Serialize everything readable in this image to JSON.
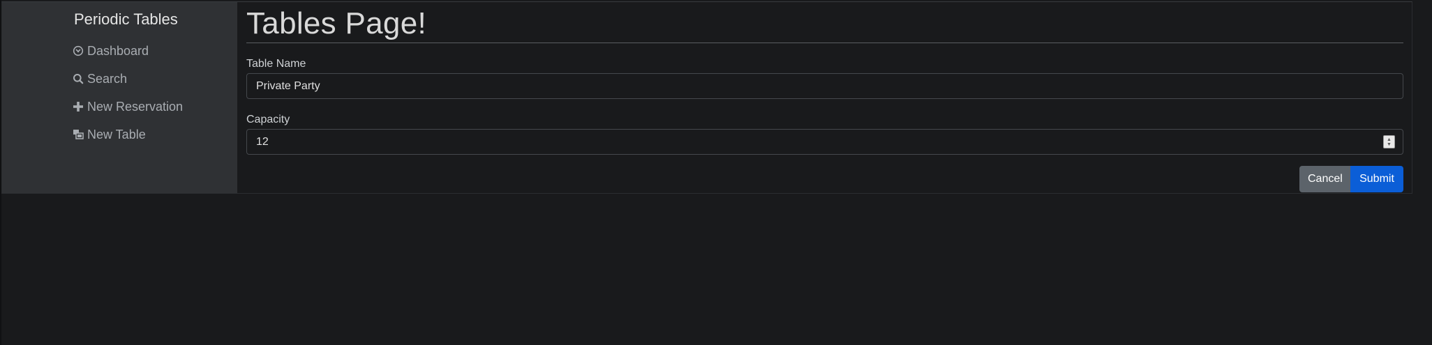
{
  "sidebar": {
    "brand": "Periodic Tables",
    "items": [
      {
        "label": "Dashboard",
        "icon": "dashboard-icon"
      },
      {
        "label": "Search",
        "icon": "search-icon"
      },
      {
        "label": "New Reservation",
        "icon": "plus-icon"
      },
      {
        "label": "New Table",
        "icon": "table-icon"
      }
    ]
  },
  "main": {
    "title": "Tables Page!",
    "form": {
      "table_name_label": "Table Name",
      "table_name_value": "Private Party",
      "capacity_label": "Capacity",
      "capacity_value": "12",
      "cancel_label": "Cancel",
      "submit_label": "Submit"
    }
  },
  "colors": {
    "background": "#191a1c",
    "sidebar": "#2f3134",
    "cancel_button": "#5c636a",
    "submit_button": "#0b5ed7"
  }
}
